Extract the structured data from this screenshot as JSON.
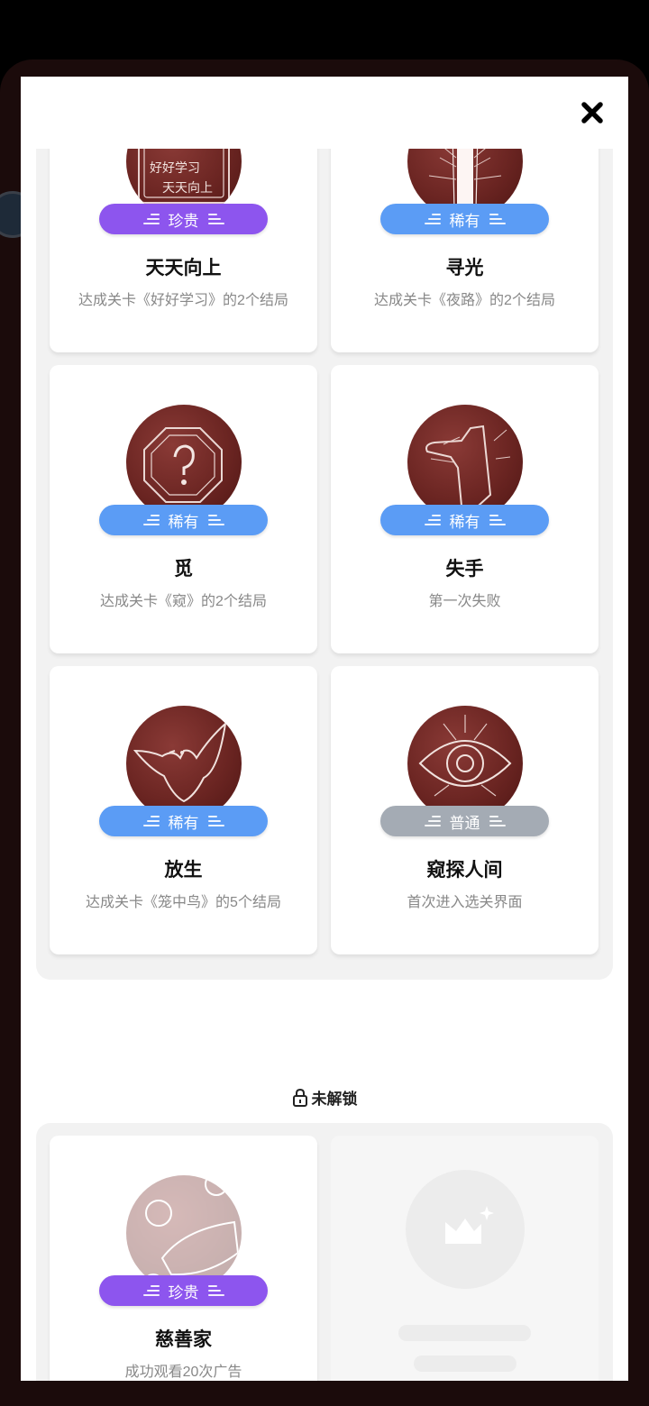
{
  "colors": {
    "rare_blue": "#5b9cf5",
    "precious_purple": "#8d55ee",
    "common_gray": "#a4abb4",
    "medal_red": "#6b2522"
  },
  "modal": {
    "close_icon": "close-icon"
  },
  "unlocked": [
    {
      "medal": "medal-study-icon",
      "tag": "珍贵",
      "tier": "precious",
      "title": "天天向上",
      "desc": "达成关卡《好好学习》的2个结局"
    },
    {
      "medal": "medal-light-icon",
      "tag": "稀有",
      "tier": "rare",
      "title": "寻光",
      "desc": "达成关卡《夜路》的2个结局"
    },
    {
      "medal": "medal-search-icon",
      "tag": "稀有",
      "tier": "rare",
      "title": "觅",
      "desc": "达成关卡《窥》的2个结局"
    },
    {
      "medal": "medal-hand-icon",
      "tag": "稀有",
      "tier": "rare",
      "title": "失手",
      "desc": "第一次失败"
    },
    {
      "medal": "medal-bird-icon",
      "tag": "稀有",
      "tier": "rare",
      "title": "放生",
      "desc": "达成关卡《笼中鸟》的5个结局"
    },
    {
      "medal": "medal-eye-icon",
      "tag": "普通",
      "tier": "common",
      "title": "窥探人间",
      "desc": "首次进入选关界面"
    }
  ],
  "locked_section": {
    "label": "未解锁",
    "icon": "lock-icon"
  },
  "locked": [
    {
      "medal": "medal-charity-icon",
      "tag": "珍贵",
      "tier": "precious",
      "title": "慈善家",
      "desc": "成功观看20次广告"
    }
  ]
}
